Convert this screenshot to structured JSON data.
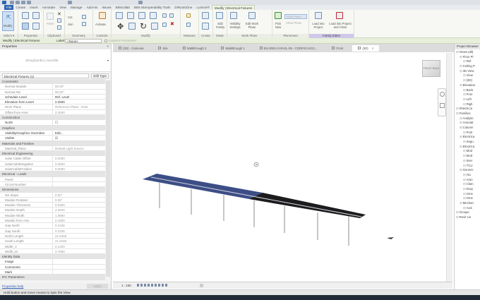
{
  "ribbon_tabs": [
    "File",
    "Create",
    "Insert",
    "Annotate",
    "View",
    "Manage",
    "Add-Ins",
    "Issues",
    "BIMcollab",
    "BIM Interoperability Tools",
    "DiRootsOne",
    "Lumion®",
    "Modify | Electrical Fixtures"
  ],
  "ribbon": {
    "modify_button": "Modify",
    "select": "Select ▾",
    "properties": "Properties",
    "clipboard": "Clipboard",
    "paste": "Paste",
    "cut": "Cut",
    "join": "Join",
    "geometry": "Geometry",
    "activate": "Activate",
    "controls": "Controls",
    "modify_panel": "Modify",
    "measure": "Measure",
    "create": "Create",
    "edit_family": "Edit Family",
    "mode": "Mode",
    "visibility_settings": "Visibility Settings",
    "edit_work_plane": "Edit Work Plane",
    "work_plane": "Work Plane",
    "pick_new": "Pick New",
    "work_plane_field": "Work Plane",
    "show_plane": "Show Plane",
    "placement": "Placement",
    "load_into_project": "Load into Project",
    "load_into_project_close": "Load into Project and Close",
    "family_editor": "Family Editor"
  },
  "options_bar": {
    "context": "Modify | Electrical Fixtures",
    "label_caption": "Label:",
    "label_value": "<None>",
    "instance_parameter": "Instance Parameter"
  },
  "view_tabs": [
    {
      "label": "{3D} - Carinosa",
      "icon": "3d-view-icon"
    },
    {
      "label": "Site",
      "icon": "plan-icon"
    },
    {
      "label": "Walkthrough 2",
      "icon": "walkthrough-icon"
    },
    {
      "label": "Walkthrough 1",
      "icon": "walkthrough-icon"
    },
    {
      "label": "ES-GEN-CAR-EL-09 - CODIFICACIO...",
      "icon": "sheet-icon"
    },
    {
      "label": "Front",
      "icon": "elevation-icon"
    },
    {
      "label": "{3D}",
      "icon": "3d-view-icon",
      "active": true
    }
  ],
  "properties": {
    "title": "Properties",
    "type_name": "StringSymbol_monofila",
    "selector": "Electrical Fixtures (1)",
    "edit_type": "Edit Type",
    "rows": [
      {
        "group": "Constraints"
      },
      {
        "k": "Normal Module",
        "v": "90.00°"
      },
      {
        "k": "Normal NS",
        "v": "90.00°"
      },
      {
        "k": "Schedule Level",
        "v": "Ref. Level",
        "edit": true
      },
      {
        "k": "Elevation from Level",
        "v": "2.2500",
        "edit": true
      },
      {
        "k": "Work Plane",
        "v": "Reference Plane : East"
      },
      {
        "k": "Offset from Host",
        "v": "2.2500"
      },
      {
        "group": "Construction"
      },
      {
        "k": "North",
        "v": "☐",
        "edit": true
      },
      {
        "group": "Graphics"
      },
      {
        "k": "Visibility/Graphics Overrides",
        "v": "Edit...",
        "edit": true
      },
      {
        "k": "Visible",
        "v": "☑",
        "edit": true
      },
      {
        "group": "Materials and Finishes"
      },
      {
        "k": "Material_Placa",
        "v": "Default Light Source"
      },
      {
        "group": "Electrical Engineering"
      },
      {
        "k": "Solar Cable Offset",
        "v": "0.0000"
      },
      {
        "k": "SolarCableNegative",
        "v": "0.0000"
      },
      {
        "k": "SolarCablePositive",
        "v": "0.0000"
      },
      {
        "group": "Electrical - Loads"
      },
      {
        "k": "Panel",
        "v": ""
      },
      {
        "k": "Circuit Number",
        "v": ""
      },
      {
        "group": "Dimensions"
      },
      {
        "k": "NS Slope",
        "v": "0.00°"
      },
      {
        "k": "Module Rotation",
        "v": "0.00°"
      },
      {
        "k": "Module Thickness",
        "v": "0.0300"
      },
      {
        "k": "Module Depth",
        "v": "2.3840"
      },
      {
        "k": "Module Width",
        "v": "1.0960"
      },
      {
        "k": "Module from Axis",
        "v": "0.1800"
      },
      {
        "k": "Gap North",
        "v": "0.2105"
      },
      {
        "k": "Gap South",
        "v": "0.2105"
      },
      {
        "k": "North Length",
        "v": "21.5150"
      },
      {
        "k": "South Length",
        "v": "21.5150"
      },
      {
        "k": "Width_V",
        "v": "0.1200"
      },
      {
        "k": "Width_M",
        "v": "4.7680"
      },
      {
        "group": "Identity Data"
      },
      {
        "k": "Image",
        "v": "",
        "edit": true
      },
      {
        "k": "Comments",
        "v": "",
        "edit": true
      },
      {
        "k": "Mark",
        "v": "",
        "edit": true
      },
      {
        "group": "IFC Parameters"
      }
    ],
    "help_link": "Properties help",
    "apply": "Apply"
  },
  "viewport": {
    "scale": "1 : 100",
    "navcube_faces": [
      "FRONT",
      "BACK"
    ],
    "panel_colors": {
      "blue": "#3d4e86",
      "black": "#1c1c1c"
    }
  },
  "browser": {
    "title": "Project Browser",
    "items": [
      {
        "t": "Views (all)",
        "d": 0
      },
      {
        "t": "Floor Pl",
        "d": 1
      },
      {
        "t": "Ref",
        "d": 2
      },
      {
        "t": "Ceiling P",
        "d": 1
      },
      {
        "t": "3D View",
        "d": 1
      },
      {
        "t": "View",
        "d": 2
      },
      {
        "t": "{3D}",
        "d": 2
      },
      {
        "t": "Elevation",
        "d": 1
      },
      {
        "t": "Back",
        "d": 2
      },
      {
        "t": "Fron",
        "d": 2
      },
      {
        "t": "Left",
        "d": 2
      },
      {
        "t": "Righ",
        "d": 2
      },
      {
        "t": "Sheets (a",
        "d": 0
      },
      {
        "t": "Families",
        "d": 0
      },
      {
        "t": "Analytic",
        "d": 1
      },
      {
        "t": "Annotat",
        "d": 1
      },
      {
        "t": "Column",
        "d": 1
      },
      {
        "t": "Post",
        "d": 2
      },
      {
        "t": "Electrica",
        "d": 1
      },
      {
        "t": "Segu",
        "d": 2
      },
      {
        "t": "Electrica",
        "d": 1
      },
      {
        "t": "Mod",
        "d": 2
      },
      {
        "t": "Mod",
        "d": 2
      },
      {
        "t": "Serv",
        "d": 2
      },
      {
        "t": "TCU",
        "d": 2
      },
      {
        "t": "Generic",
        "d": 1
      },
      {
        "t": "Alu",
        "d": 2
      },
      {
        "t": "Aran",
        "d": 2
      },
      {
        "t": "Clam",
        "d": 2
      },
      {
        "t": "Drop",
        "d": 2
      },
      {
        "t": "Ome",
        "d": 2
      },
      {
        "t": "Ome",
        "d": 2
      },
      {
        "t": "Mechan",
        "d": 1
      },
      {
        "t": "Axis",
        "d": 2
      },
      {
        "t": "Groups",
        "d": 0
      },
      {
        "t": "Revit Lin",
        "d": 0
      }
    ]
  },
  "status": "Hold button and move mouse to Spin the View."
}
